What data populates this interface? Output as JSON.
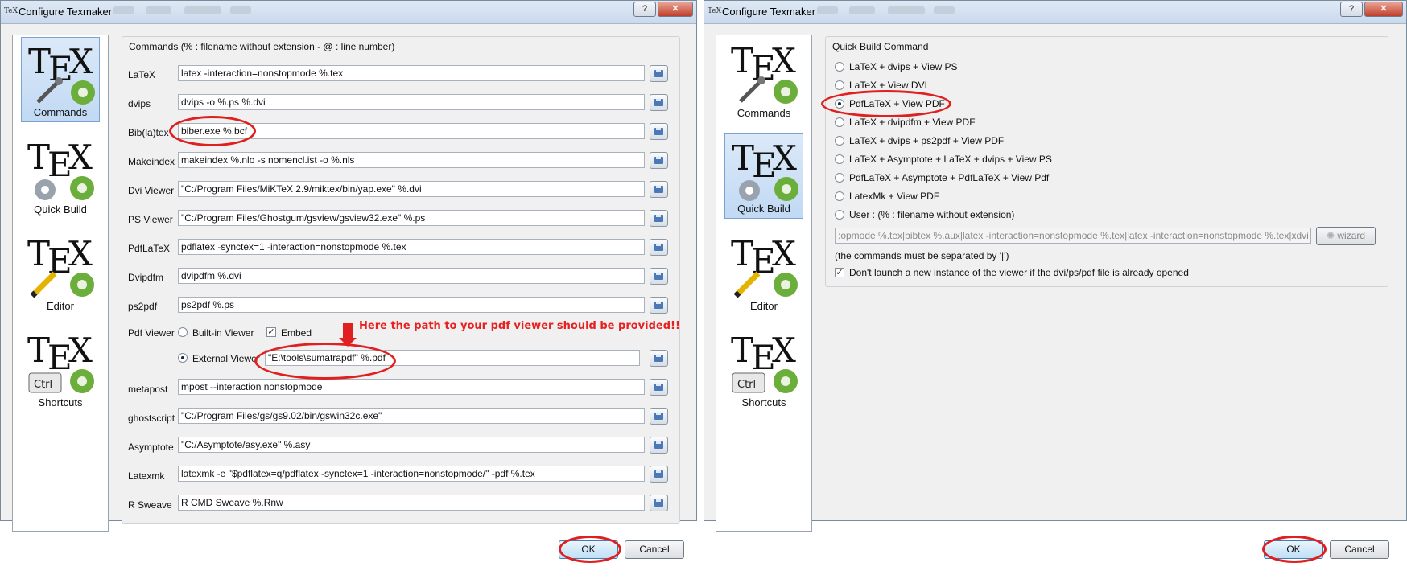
{
  "left_window": {
    "title": "Configure Texmaker",
    "title_buttons": {
      "help": "?",
      "close": "✕"
    },
    "pages": [
      {
        "label": "Commands",
        "icon": "commands-icon",
        "selected": true
      },
      {
        "label": "Quick Build",
        "icon": "quick-build-icon",
        "selected": false
      },
      {
        "label": "Editor",
        "icon": "editor-icon",
        "selected": false
      },
      {
        "label": "Shortcuts",
        "icon": "shortcuts-icon",
        "selected": false
      }
    ],
    "group_title": "Commands (% : filename without extension - @ : line number)",
    "commands": [
      {
        "label": "LaTeX",
        "value": "latex -interaction=nonstopmode %.tex"
      },
      {
        "label": "dvips",
        "value": "dvips -o %.ps %.dvi"
      },
      {
        "label": "Bib(la)tex",
        "value": "biber.exe %.bcf"
      },
      {
        "label": "Makeindex",
        "value": "makeindex %.nlo -s nomencl.ist -o %.nls"
      },
      {
        "label": "Dvi Viewer",
        "value": "\"C:/Program Files/MiKTeX 2.9/miktex/bin/yap.exe\" %.dvi"
      },
      {
        "label": "PS Viewer",
        "value": "\"C:/Program Files/Ghostgum/gsview/gsview32.exe\" %.ps"
      },
      {
        "label": "PdfLaTeX",
        "value": "pdflatex -synctex=1 -interaction=nonstopmode %.tex"
      },
      {
        "label": "Dvipdfm",
        "value": "dvipdfm %.dvi"
      },
      {
        "label": "ps2pdf",
        "value": "ps2pdf %.ps"
      }
    ],
    "pdf_viewer": {
      "label": "Pdf Viewer",
      "builtin_label": "Built-in Viewer",
      "embed_label": "Embed",
      "external_label": "External Viewer",
      "external_value": "\"E:\\tools\\sumatrapdf\" %.pdf"
    },
    "commands_after": [
      {
        "label": "metapost",
        "value": "mpost --interaction nonstopmode"
      },
      {
        "label": "ghostscript",
        "value": "\"C:/Program Files/gs/gs9.02/bin/gswin32c.exe\""
      },
      {
        "label": "Asymptote",
        "value": "\"C:/Asymptote/asy.exe\" %.asy"
      },
      {
        "label": "Latexmk",
        "value": "latexmk -e \"$pdflatex=q/pdflatex -synctex=1 -interaction=nonstopmode/\" -pdf %.tex"
      },
      {
        "label": "R Sweave",
        "value": "R CMD Sweave %.Rnw"
      }
    ],
    "annotation": "Here the path to your pdf viewer should be provided!!",
    "ok_label": "OK",
    "cancel_label": "Cancel"
  },
  "right_window": {
    "title": "Configure Texmaker",
    "title_buttons": {
      "help": "?",
      "close": "✕"
    },
    "pages": [
      {
        "label": "Commands",
        "icon": "commands-icon",
        "selected": false
      },
      {
        "label": "Quick Build",
        "icon": "quick-build-icon",
        "selected": true
      },
      {
        "label": "Editor",
        "icon": "editor-icon",
        "selected": false
      },
      {
        "label": "Shortcuts",
        "icon": "shortcuts-icon",
        "selected": false
      }
    ],
    "group_title": "Quick Build Command",
    "options": [
      {
        "label": "LaTeX + dvips + View PS",
        "checked": false
      },
      {
        "label": "LaTeX + View DVI",
        "checked": false
      },
      {
        "label": "PdfLaTeX + View PDF",
        "checked": true
      },
      {
        "label": "LaTeX + dvipdfm + View PDF",
        "checked": false
      },
      {
        "label": "LaTeX + dvips + ps2pdf + View PDF",
        "checked": false
      },
      {
        "label": "LaTeX + Asymptote + LaTeX + dvips + View PS",
        "checked": false
      },
      {
        "label": "PdfLaTeX + Asymptote + PdfLaTeX + View Pdf",
        "checked": false
      },
      {
        "label": "LatexMk + View PDF",
        "checked": false
      },
      {
        "label": "User : (% : filename without extension)",
        "checked": false
      }
    ],
    "user_command": ":opmode %.tex|bibtex %.aux|latex -interaction=nonstopmode %.tex|latex -interaction=nonstopmode %.tex|xdvi %.dvi",
    "wizard_label": "wizard",
    "separator_note": "(the commands must be separated by '|')",
    "dont_launch_label": "Don't launch a new instance of the viewer if the dvi/ps/pdf file is already opened",
    "dont_launch_checked": true,
    "ok_label": "OK",
    "cancel_label": "Cancel"
  },
  "colors": {
    "highlight_red": "#e02020",
    "selection_blue": "#c1d9f4"
  }
}
